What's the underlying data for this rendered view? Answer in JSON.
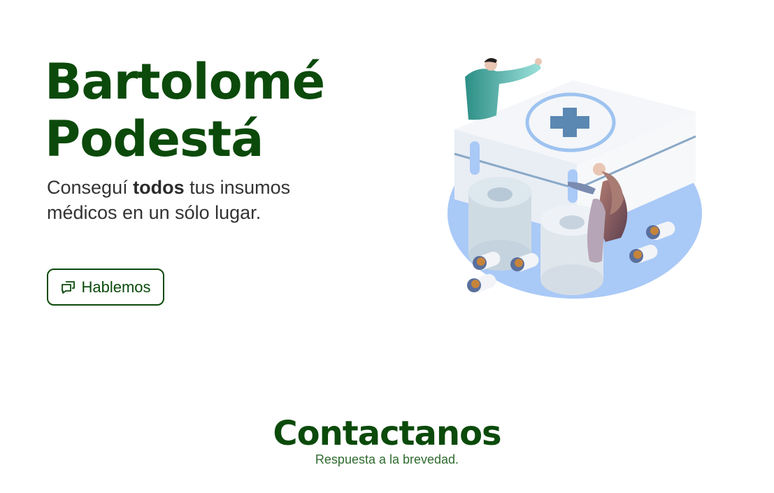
{
  "hero": {
    "title_line1": "Bartolomé",
    "title_line2": "Podestá",
    "subtitle_pre": "Conseguí",
    "subtitle_bold": "todos",
    "subtitle_post": "tus insumos médicos en un sólo lugar.",
    "cta_label": "Hablemos",
    "cta_icon": "chat-bubbles-icon"
  },
  "contact": {
    "title": "Contactanos",
    "subtitle": "Respuesta a la brevedad."
  },
  "colors": {
    "brand_green": "#0b4a0b",
    "subtitle_green": "#2f6b2f",
    "text_dark": "#333333",
    "illustration_blue": "#9ec3f5",
    "cross_blue": "#5b88b3"
  }
}
